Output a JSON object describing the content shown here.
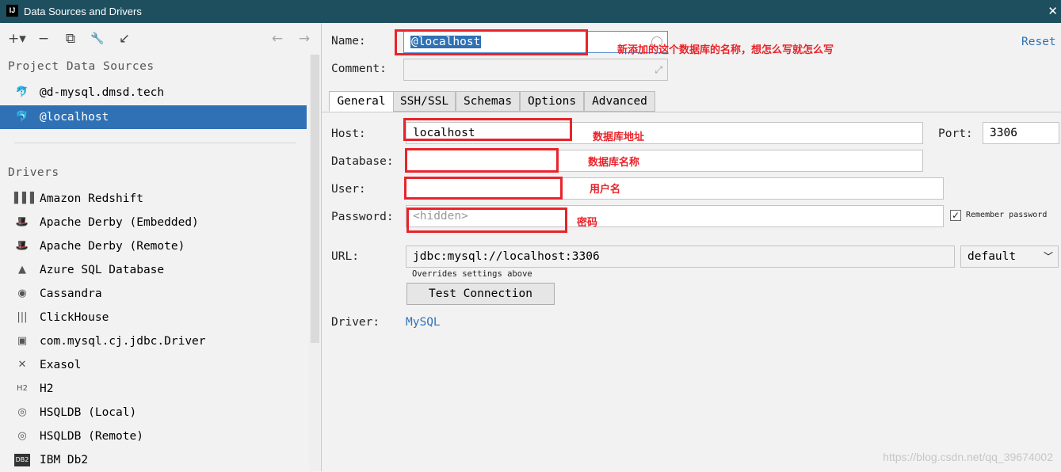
{
  "window": {
    "title": "Data Sources and Drivers",
    "app_icon_text": "IJ",
    "close_glyph": "✕"
  },
  "toolbar": {
    "buttons": [
      {
        "name": "add",
        "glyph": "+▾"
      },
      {
        "name": "remove",
        "glyph": "−"
      },
      {
        "name": "duplicate",
        "glyph": "⧉"
      },
      {
        "name": "driver-settings",
        "glyph": "🔧"
      },
      {
        "name": "import",
        "glyph": "↙"
      },
      {
        "name": "back",
        "glyph": "←"
      },
      {
        "name": "forward",
        "glyph": "→"
      }
    ]
  },
  "sidebar": {
    "project_title": "Project Data Sources",
    "project_items": [
      {
        "label": "@d-mysql.dmsd.tech",
        "icon": "mysql-dolphin-icon",
        "glyph": "🐬"
      },
      {
        "label": "@localhost",
        "icon": "mysql-dolphin-icon",
        "glyph": "🐬",
        "selected": true
      }
    ],
    "drivers_title": "Drivers",
    "drivers": [
      {
        "label": "Amazon Redshift",
        "icon": "redshift-icon",
        "glyph": "▌▌▌"
      },
      {
        "label": "Apache Derby (Embedded)",
        "icon": "derby-hat-icon",
        "glyph": "🎩"
      },
      {
        "label": "Apache Derby (Remote)",
        "icon": "derby-hat-icon",
        "glyph": "🎩"
      },
      {
        "label": "Azure SQL Database",
        "icon": "azure-icon",
        "glyph": "▲"
      },
      {
        "label": "Cassandra",
        "icon": "cassandra-eye-icon",
        "glyph": "◉"
      },
      {
        "label": "ClickHouse",
        "icon": "clickhouse-icon",
        "glyph": "|||"
      },
      {
        "label": "com.mysql.cj.jdbc.Driver",
        "icon": "generic-driver-icon",
        "glyph": "▣"
      },
      {
        "label": "Exasol",
        "icon": "exasol-x-icon",
        "glyph": "✕"
      },
      {
        "label": "H2",
        "icon": "h2-icon",
        "glyph": "H2"
      },
      {
        "label": "HSQLDB (Local)",
        "icon": "hsqldb-icon",
        "glyph": "◎"
      },
      {
        "label": "HSQLDB (Remote)",
        "icon": "hsqldb-icon",
        "glyph": "◎"
      },
      {
        "label": "IBM Db2",
        "icon": "ibm-db2-icon",
        "glyph": "DB2"
      }
    ]
  },
  "form": {
    "name_label": "Name:",
    "name_value": "@localhost",
    "reset_label": "Reset",
    "comment_label": "Comment:",
    "comment_value": "",
    "tabs": [
      "General",
      "SSH/SSL",
      "Schemas",
      "Options",
      "Advanced"
    ],
    "active_tab": "General",
    "host_label": "Host:",
    "host_value": "localhost",
    "port_label": "Port:",
    "port_value": "3306",
    "database_label": "Database:",
    "database_value": "",
    "user_label": "User:",
    "user_value": "",
    "password_label": "Password:",
    "password_placeholder": "<hidden>",
    "remember_password_label": "Remember password",
    "remember_password_checked": true,
    "url_label": "URL:",
    "url_value": "jdbc:mysql://localhost:3306",
    "url_mode": "default",
    "url_note": "Overrides settings above",
    "test_connection_label": "Test Connection",
    "driver_label": "Driver:",
    "driver_value": "MySQL"
  },
  "annotations": {
    "name_note": "新添加的这个数据库的名称，想怎么写就怎么写",
    "host_note": "数据库地址",
    "database_note": "数据库名称",
    "user_note": "用户名",
    "password_note": "密码",
    "highlight_color": "#e8242a"
  },
  "watermark": "https://blog.csdn.net/qq_39674002"
}
